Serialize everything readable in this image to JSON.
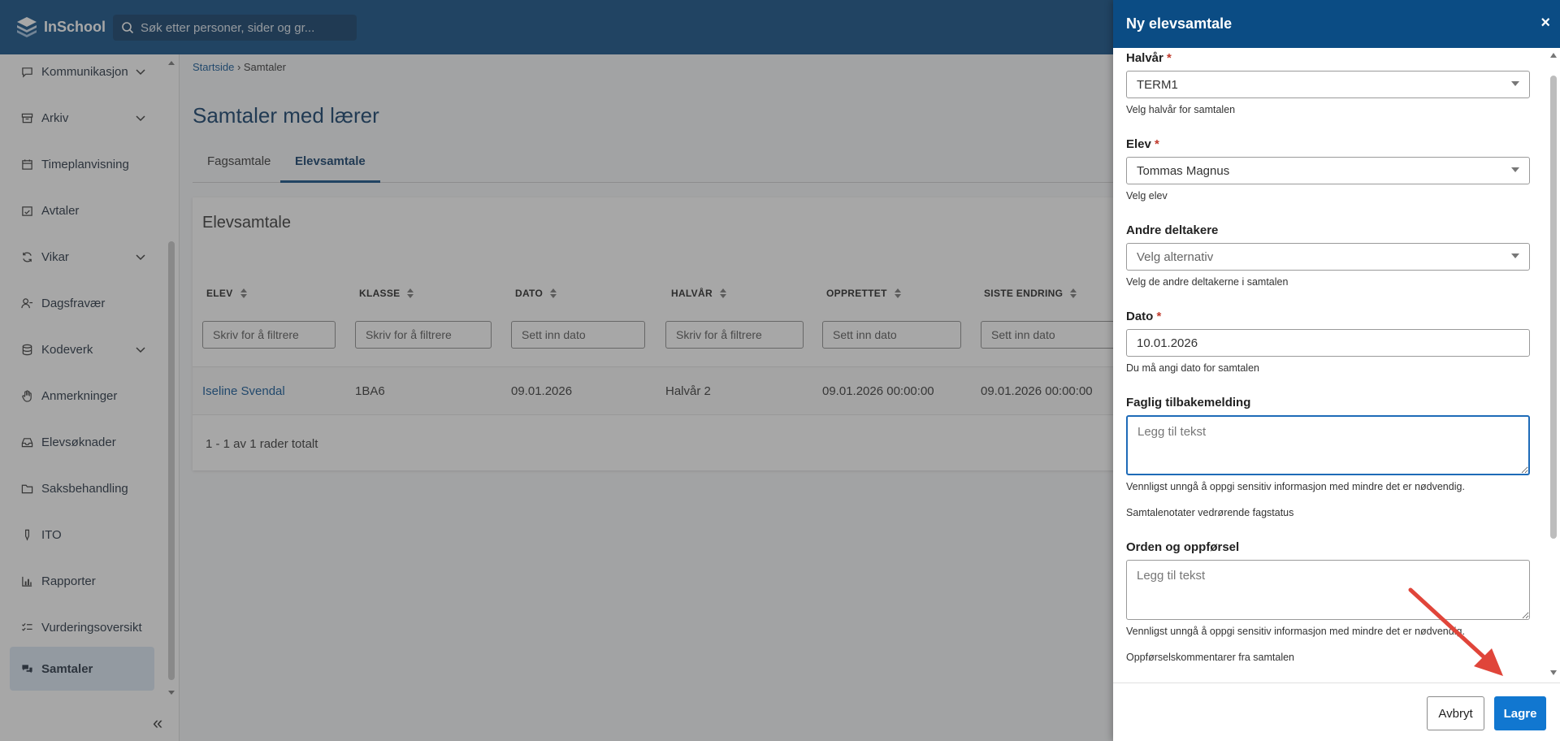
{
  "app": {
    "name": "InSchool"
  },
  "search": {
    "placeholder": "Søk etter personer, sider og gr..."
  },
  "sidebar": {
    "items": [
      {
        "label": "Kommunikasjon",
        "icon": "chat-icon",
        "expandable": true
      },
      {
        "label": "Arkiv",
        "icon": "archive-icon",
        "expandable": true
      },
      {
        "label": "Timeplanvisning",
        "icon": "calendar-icon",
        "expandable": false
      },
      {
        "label": "Avtaler",
        "icon": "calendar-check-icon",
        "expandable": false
      },
      {
        "label": "Vikar",
        "icon": "refresh-icon",
        "expandable": true
      },
      {
        "label": "Dagsfravær",
        "icon": "person-minus-icon",
        "expandable": false
      },
      {
        "label": "Kodeverk",
        "icon": "database-icon",
        "expandable": true
      },
      {
        "label": "Anmerkninger",
        "icon": "hand-icon",
        "expandable": false
      },
      {
        "label": "Elevsøknader",
        "icon": "inbox-icon",
        "expandable": false
      },
      {
        "label": "Saksbehandling",
        "icon": "folder-icon",
        "expandable": false
      },
      {
        "label": "ITO",
        "icon": "pen-icon",
        "expandable": false
      },
      {
        "label": "Rapporter",
        "icon": "bar-chart-icon",
        "expandable": false
      },
      {
        "label": "Vurderingsoversikt",
        "icon": "checklist-icon",
        "expandable": false
      },
      {
        "label": "Samtaler",
        "icon": "conversation-icon",
        "expandable": false,
        "active": true
      }
    ]
  },
  "breadcrumb": {
    "home": "Startside",
    "current": "Samtaler"
  },
  "page": {
    "title": "Samtaler med lærer"
  },
  "tabs": [
    {
      "label": "Fagsamtale"
    },
    {
      "label": "Elevsamtale",
      "active": true
    }
  ],
  "table": {
    "title": "Elevsamtale",
    "columns": [
      "ELEV",
      "KLASSE",
      "DATO",
      "HALVÅR",
      "OPPRETTET",
      "SISTE ENDRING"
    ],
    "filters": [
      "Skriv for å filtrere",
      "Skriv for å filtrere",
      "Sett inn dato",
      "Skriv for å filtrere",
      "Sett inn dato",
      "Sett inn dato"
    ],
    "rows": [
      [
        "Iseline Svendal",
        "1BA6",
        "09.01.2026",
        "Halvår 2",
        "09.01.2026 00:00:00",
        "09.01.2026 00:00:00"
      ]
    ],
    "footer": "1 - 1 av 1 rader totalt"
  },
  "panel": {
    "title": "Ny elevsamtale",
    "close": "×",
    "fields": {
      "halvar": {
        "label": "Halvår",
        "required": "*",
        "value": "TERM1",
        "help": "Velg halvår for samtalen"
      },
      "elev": {
        "label": "Elev",
        "required": "*",
        "value": "Tommas Magnus",
        "help": "Velg elev"
      },
      "andre": {
        "label": "Andre deltakere",
        "placeholder": "Velg alternativ",
        "help": "Velg de andre deltakerne i samtalen"
      },
      "dato": {
        "label": "Dato",
        "required": "*",
        "value": "10.01.2026",
        "help": "Du må angi dato for samtalen"
      },
      "faglig": {
        "label": "Faglig tilbakemelding",
        "placeholder": "Legg til tekst",
        "help1": "Vennligst unngå å oppgi sensitiv informasjon med mindre det er nødvendig.",
        "help2": "Samtalenotater vedrørende fagstatus"
      },
      "orden": {
        "label": "Orden og oppførsel",
        "placeholder": "Legg til tekst",
        "help1": "Vennligst unngå å oppgi sensitiv informasjon med mindre det er nødvendig.",
        "help2": "Oppførselskommentarer fra samtalen"
      }
    },
    "buttons": {
      "cancel": "Avbryt",
      "save": "Lagre"
    }
  },
  "colors": {
    "brand": "#0b4c84",
    "accent": "#1177d0",
    "required": "#c0392b",
    "annotation_arrow": "#e0453a"
  }
}
